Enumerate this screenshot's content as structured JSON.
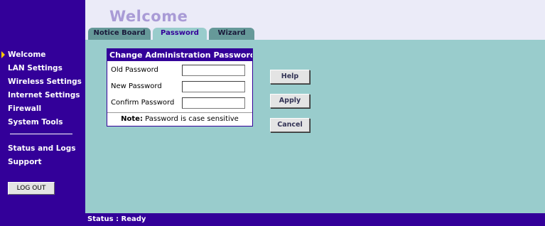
{
  "header": {
    "title": "Welcome",
    "tabs": [
      {
        "label": "Notice Board",
        "active": false
      },
      {
        "label": "Password",
        "active": true
      },
      {
        "label": "Wizard",
        "active": false
      }
    ]
  },
  "sidebar": {
    "items": [
      {
        "label": "Welcome",
        "active": true
      },
      {
        "label": "LAN Settings"
      },
      {
        "label": "Wireless Settings"
      },
      {
        "label": "Internet Settings"
      },
      {
        "label": "Firewall"
      },
      {
        "label": "System Tools"
      },
      {
        "label": "Status and Logs"
      },
      {
        "label": "Support"
      }
    ],
    "logout_label": "LOG OUT"
  },
  "password_box": {
    "title": "Change Administration Password",
    "fields": [
      {
        "label": "Old Password",
        "value": ""
      },
      {
        "label": "New Password",
        "value": ""
      },
      {
        "label": "Confirm Password",
        "value": ""
      }
    ],
    "note_prefix": "Note:",
    "note_text": "Password is case sensitive"
  },
  "buttons": {
    "help": "Help",
    "apply": "Apply",
    "cancel": "Cancel"
  },
  "status": {
    "text": "Status : Ready"
  },
  "colors": {
    "sidebar_bg": "#330099",
    "content_bg": "#99cccc",
    "header_bg": "#ebebf8",
    "tab_inactive": "#669999",
    "title_color": "#a99bd6"
  },
  "icons": {
    "active_nav_marker": "triangle-right-icon"
  }
}
